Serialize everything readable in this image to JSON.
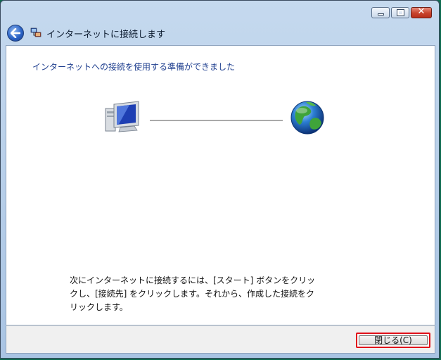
{
  "window": {
    "title": "インターネットに接続します",
    "caption_buttons": {
      "minimize_icon": "minimize-icon",
      "maximize_icon": "maximize-icon",
      "close_glyph": "✕"
    }
  },
  "content": {
    "heading": "インターネットへの接続を使用する準備ができました",
    "diagram": {
      "left_icon": "computer-icon",
      "right_icon": "globe-icon"
    },
    "info_lines": [
      "次にインターネットに接続するには、[スタート] ボタンをクリッ",
      "クし、[接続先] をクリックします。それから、作成した接続をク",
      "リックします。"
    ]
  },
  "footer": {
    "close_button_label": "閉じる(C)"
  },
  "colors": {
    "heading": "#1f3f8f",
    "focus_border": "#e0101a"
  }
}
